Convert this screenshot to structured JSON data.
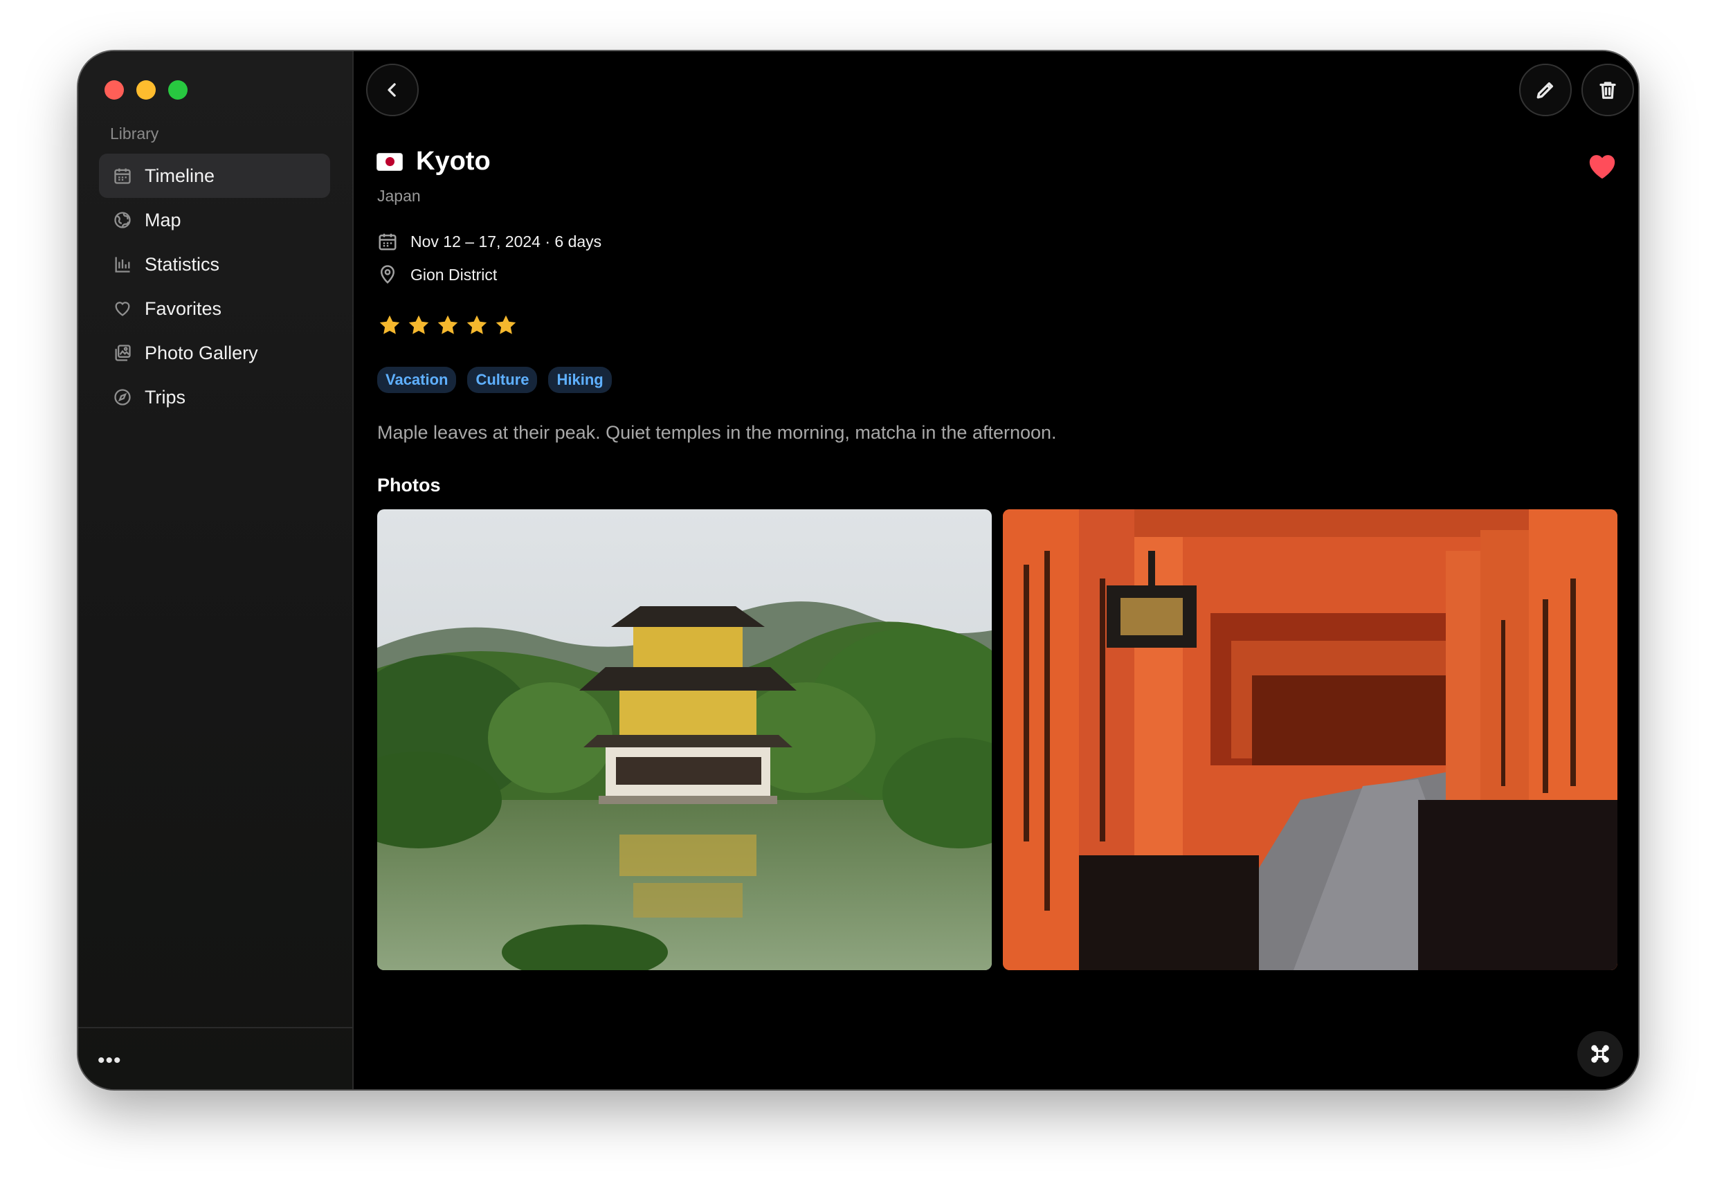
{
  "sidebar": {
    "section_label": "Library",
    "items": [
      {
        "label": "Timeline",
        "icon": "calendar-icon",
        "active": true
      },
      {
        "label": "Map",
        "icon": "globe-icon"
      },
      {
        "label": "Statistics",
        "icon": "bar-chart-icon"
      },
      {
        "label": "Favorites",
        "icon": "heart-icon"
      },
      {
        "label": "Photo Gallery",
        "icon": "photos-icon"
      },
      {
        "label": "Trips",
        "icon": "compass-icon"
      }
    ],
    "more_label": "•••"
  },
  "toolbar": {
    "back_icon": "chevron-left-icon",
    "edit_icon": "pencil-icon",
    "delete_icon": "trash-icon"
  },
  "entry": {
    "flag": "Japan flag",
    "title": "Kyoto",
    "country": "Japan",
    "favorite": true,
    "date_range": "Nov 12 – 17, 2024 · 6 days",
    "location": "Gion District",
    "rating": 5,
    "tags": [
      "Vacation",
      "Culture",
      "Hiking"
    ],
    "description": "Maple leaves at their peak. Quiet temples in the morning, matcha in the afternoon.",
    "photos_label": "Photos"
  },
  "colors": {
    "accent_tag_text": "#5fb0ff",
    "heart": "#ff4d5a",
    "star": "#f5b82e"
  }
}
